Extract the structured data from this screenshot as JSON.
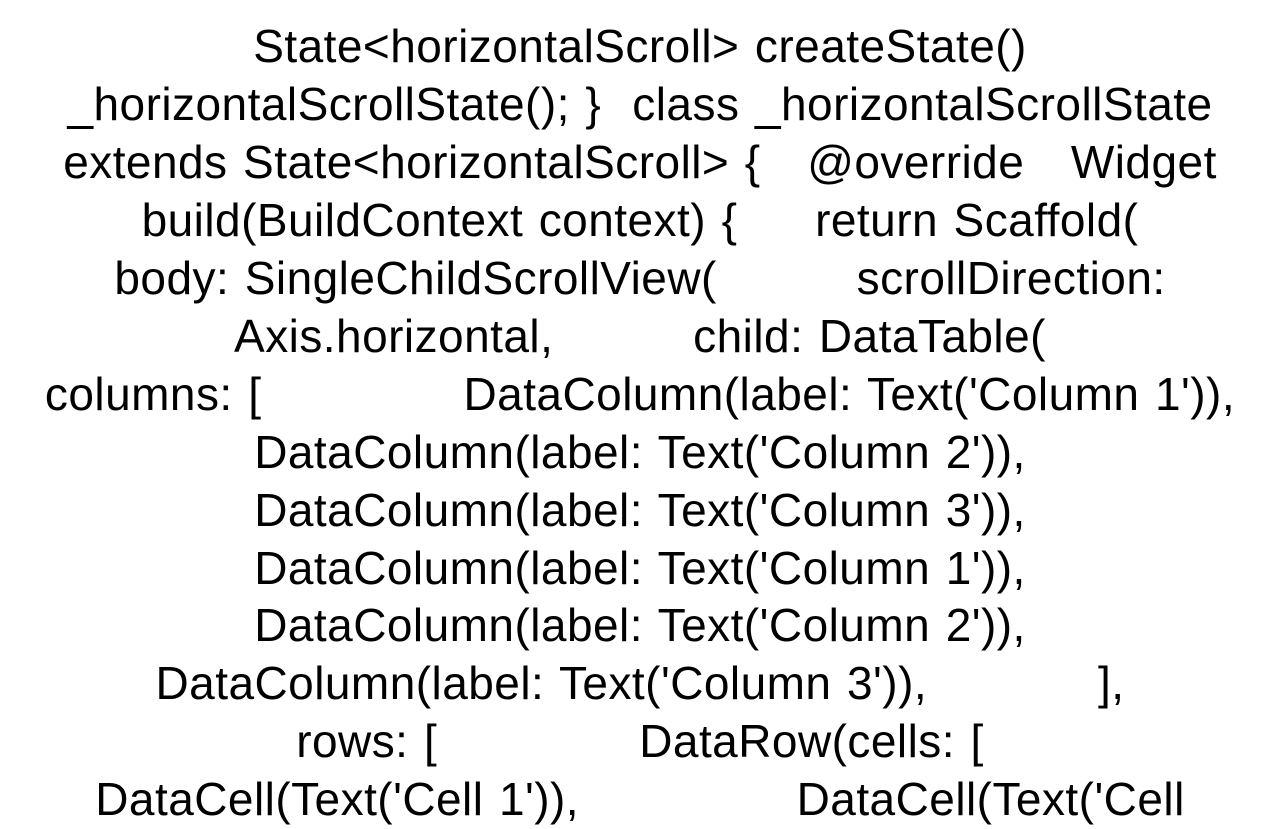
{
  "code": {
    "line1": "State<horizontalScroll> createState()",
    "line2": "_horizontalScrollState(); }  class _horizontalScrollState",
    "line3": "extends State<horizontalScroll> {   @override   Widget",
    "line4": "build(BuildContext context) {     return Scaffold(",
    "line5": "body: SingleChildScrollView(         scrollDirection:",
    "line6": "Axis.horizontal,         child: DataTable(",
    "line7": "columns: [             DataColumn(label: Text('Column 1')),",
    "line8": "DataColumn(label: Text('Column 2')),",
    "line9": "DataColumn(label: Text('Column 3')),",
    "line10": "DataColumn(label: Text('Column 1')),",
    "line11": "DataColumn(label: Text('Column 2')),",
    "line12": "DataColumn(label: Text('Column 3')),           ],",
    "line13": "rows: [             DataRow(cells: [",
    "line14": "DataCell(Text('Cell 1')),              DataCell(Text('Cell"
  }
}
